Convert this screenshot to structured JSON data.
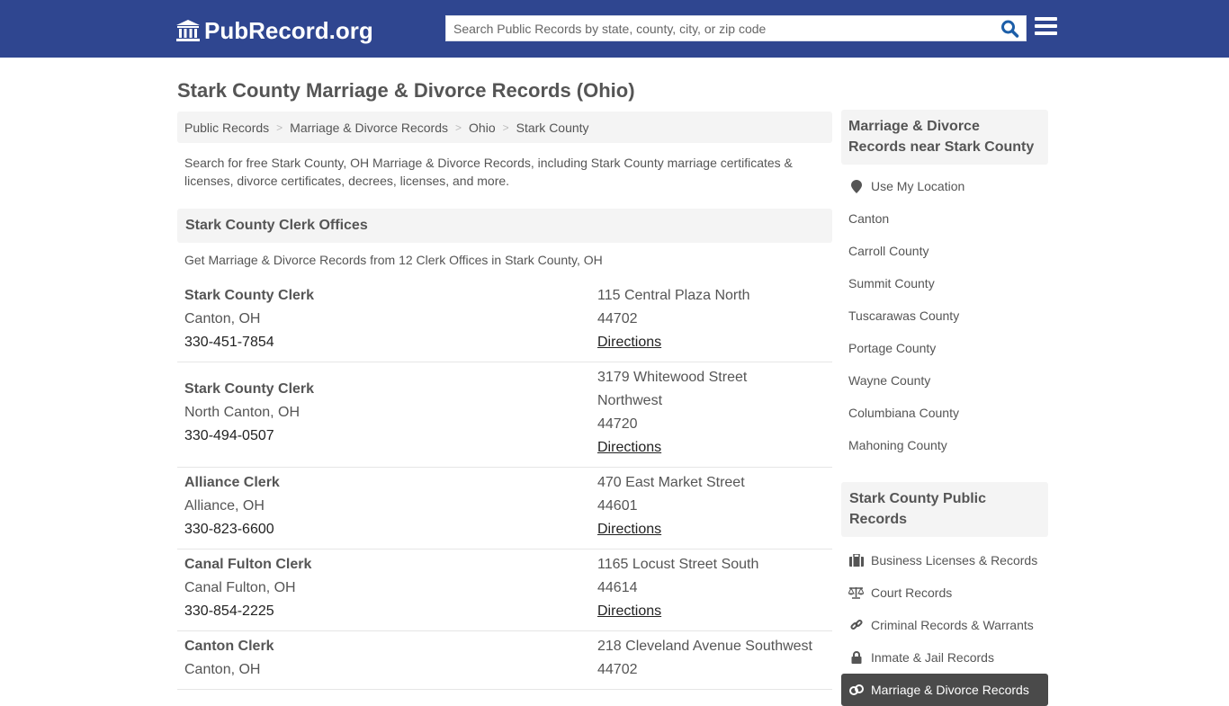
{
  "header": {
    "logo_text": "PubRecord.org",
    "search_placeholder": "Search Public Records by state, county, city, or zip code",
    "search_value": ""
  },
  "page": {
    "title": "Stark County Marriage & Divorce Records (Ohio)",
    "breadcrumb": [
      "Public Records",
      "Marriage & Divorce Records",
      "Ohio",
      "Stark County"
    ],
    "intro": "Search for free Stark County, OH Marriage & Divorce Records, including Stark County marriage certificates & licenses, divorce certificates, decrees, licenses, and more."
  },
  "clerk_section": {
    "heading": "Stark County Clerk Offices",
    "subheading": "Get Marriage & Divorce Records from 12 Clerk Offices in Stark County, OH",
    "directions_label": "Directions",
    "offices": [
      {
        "name": "Stark County Clerk",
        "city": "Canton, OH",
        "phone": "330-451-7854",
        "address": [
          "115 Central Plaza North"
        ],
        "zip": "44702"
      },
      {
        "name": "Stark County Clerk",
        "city": "North Canton, OH",
        "phone": "330-494-0507",
        "address": [
          "3179 Whitewood Street",
          "Northwest"
        ],
        "zip": "44720"
      },
      {
        "name": "Alliance Clerk",
        "city": "Alliance, OH",
        "phone": "330-823-6600",
        "address": [
          "470 East Market Street"
        ],
        "zip": "44601"
      },
      {
        "name": "Canal Fulton Clerk",
        "city": "Canal Fulton, OH",
        "phone": "330-854-2225",
        "address": [
          "1165 Locust Street South"
        ],
        "zip": "44614"
      },
      {
        "name": "Canton Clerk",
        "city": "Canton, OH",
        "phone": "",
        "address": [
          "218 Cleveland Avenue Southwest"
        ],
        "zip": "44702"
      }
    ]
  },
  "sidebar": {
    "nearby": {
      "heading": "Marriage & Divorce Records near Stark County",
      "use_location": "Use My Location",
      "items": [
        "Canton",
        "Carroll County",
        "Summit County",
        "Tuscarawas County",
        "Portage County",
        "Wayne County",
        "Columbiana County",
        "Mahoning County"
      ]
    },
    "public_records": {
      "heading": "Stark County Public Records",
      "items": [
        {
          "label": "Business Licenses & Records",
          "icon": "briefcase-icon"
        },
        {
          "label": "Court Records",
          "icon": "scales-icon"
        },
        {
          "label": "Criminal Records & Warrants",
          "icon": "link-icon"
        },
        {
          "label": "Inmate & Jail Records",
          "icon": "lock-icon"
        },
        {
          "label": "Marriage & Divorce Records",
          "icon": "rings-icon",
          "active": true
        }
      ]
    }
  },
  "colors": {
    "header_bg": "#2f4690",
    "search_icon": "#1c5ea8",
    "panel_bg": "#f4f4f4",
    "active_item_bg": "#4a4a4a"
  }
}
